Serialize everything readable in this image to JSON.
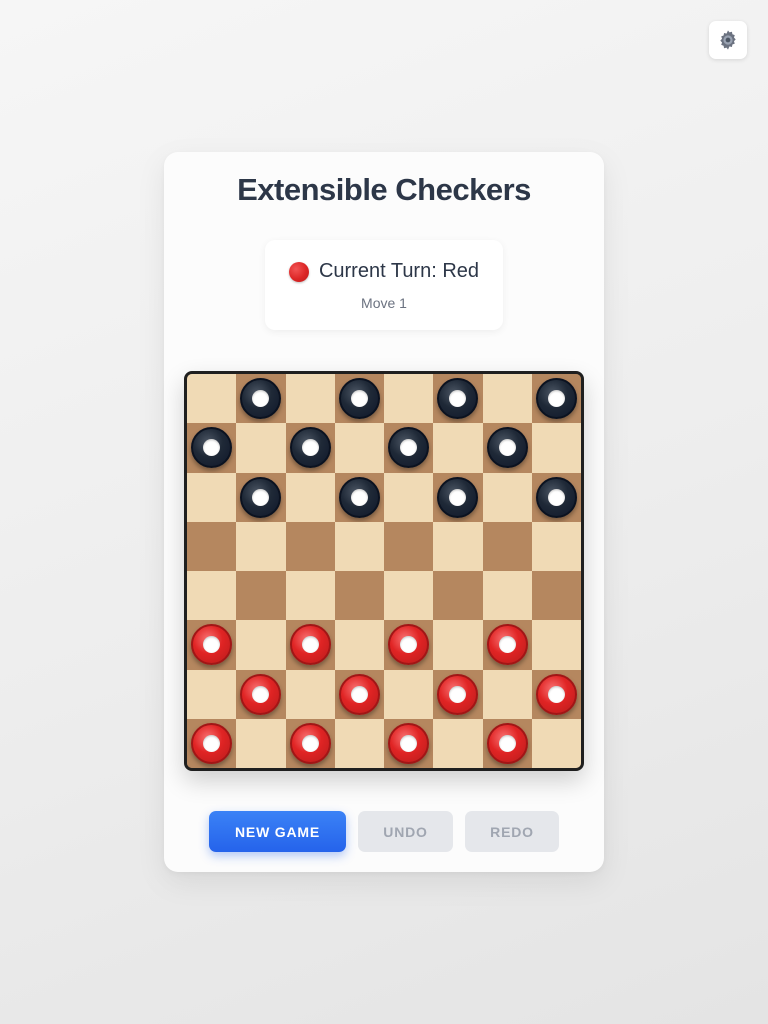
{
  "title": "Extensible Checkers",
  "turn": {
    "label": "Current Turn: Red",
    "player_color": "#dc2626",
    "move": "Move 1"
  },
  "board": {
    "size": 8,
    "light_color": "#f0dab5",
    "dark_color": "#b5875f",
    "pieces": {
      "black": [
        [
          0,
          1
        ],
        [
          0,
          3
        ],
        [
          0,
          5
        ],
        [
          0,
          7
        ],
        [
          1,
          0
        ],
        [
          1,
          2
        ],
        [
          1,
          4
        ],
        [
          1,
          6
        ],
        [
          2,
          1
        ],
        [
          2,
          3
        ],
        [
          2,
          5
        ],
        [
          2,
          7
        ]
      ],
      "red": [
        [
          5,
          0
        ],
        [
          5,
          2
        ],
        [
          5,
          4
        ],
        [
          5,
          6
        ],
        [
          6,
          1
        ],
        [
          6,
          3
        ],
        [
          6,
          5
        ],
        [
          6,
          7
        ],
        [
          7,
          0
        ],
        [
          7,
          2
        ],
        [
          7,
          4
        ],
        [
          7,
          6
        ]
      ]
    },
    "piece_colors": {
      "black": "#1f2937",
      "red": "#dc2626"
    }
  },
  "buttons": {
    "new_game": "NEW GAME",
    "undo": "UNDO",
    "redo": "REDO"
  },
  "settings": {
    "icon": "gear-icon"
  },
  "colors": {
    "primary": "#2563eb",
    "title": "#2d3748",
    "disabled_bg": "#e5e7eb",
    "disabled_text": "#a0a6b1"
  }
}
